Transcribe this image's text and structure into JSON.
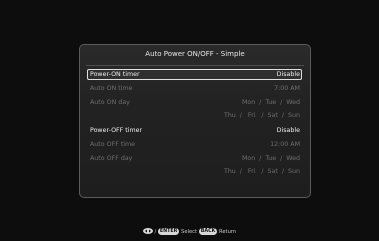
{
  "dialog": {
    "title": "Auto Power ON/OFF - Simple",
    "power_on": {
      "timer_label": "Power-ON timer",
      "timer_value": "Disable",
      "time_label": "Auto ON time",
      "time_value": "7:00 AM",
      "day_label": "Auto ON day",
      "days_row1": "Mon  /  Tue  /  Wed",
      "days_row2": "Thu  /   Fri   /  Sat  /  Sun"
    },
    "power_off": {
      "timer_label": "Power-OFF timer",
      "timer_value": "Disable",
      "time_label": "Auto OFF time",
      "time_value": "12:00 AM",
      "day_label": "Auto OFF day",
      "days_row1": "Mon  /  Tue  /  Wed",
      "days_row2": "Thu  /   Fri   /  Sat  /  Sun"
    }
  },
  "footer": {
    "nav_icon": "up-down-arrows-icon",
    "separator": "/",
    "enter_key": "ENTER",
    "select_label": "Select",
    "back_key": "BACK",
    "return_label": "Return"
  }
}
